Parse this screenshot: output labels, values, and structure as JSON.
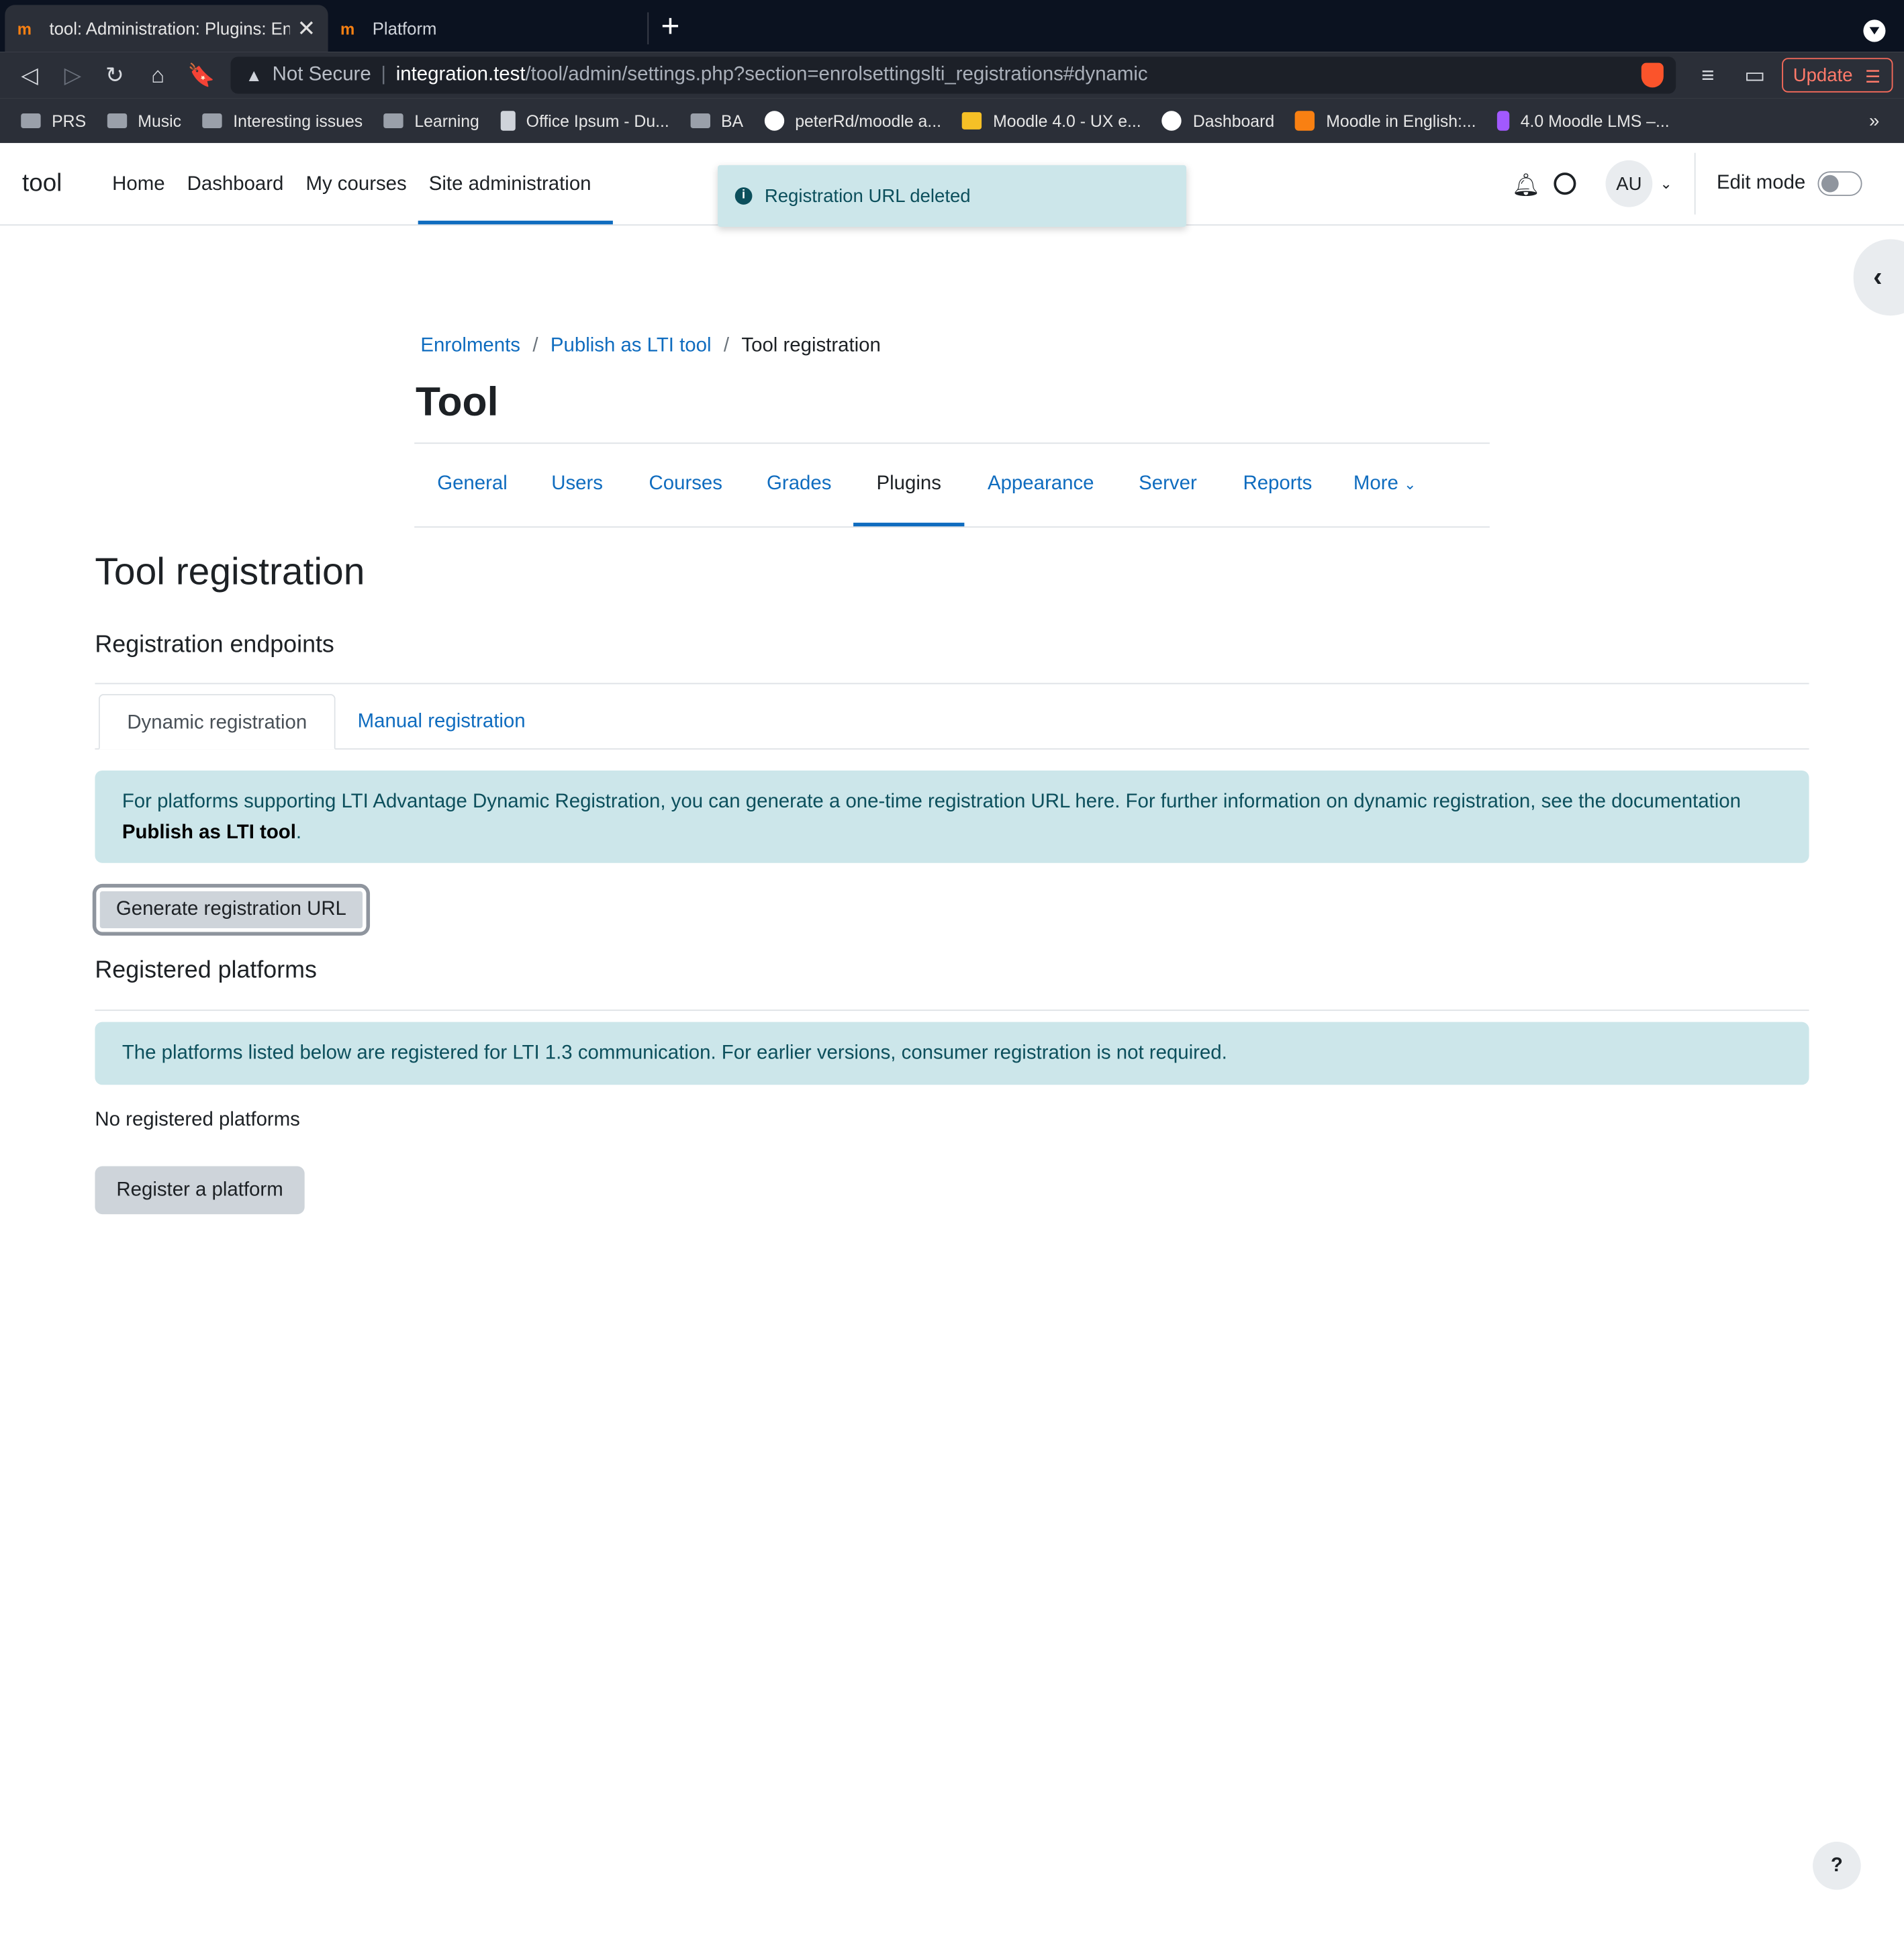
{
  "browser": {
    "tabs": [
      {
        "favicon": "moodle-m",
        "title": "tool: Administration: Plugins: Enrolments",
        "active": true
      },
      {
        "favicon": "moodle-m",
        "title": "Platform",
        "active": false
      }
    ],
    "address": {
      "security": "Not Secure",
      "host": "integration.test",
      "path": "/tool/admin/settings.php?section=enrolsettingslti_registrations#dynamic"
    },
    "update_label": "Update",
    "bookmarks": [
      {
        "icon": "folder",
        "label": "PRS"
      },
      {
        "icon": "folder",
        "label": "Music"
      },
      {
        "icon": "folder",
        "label": "Interesting issues"
      },
      {
        "icon": "folder",
        "label": "Learning"
      },
      {
        "icon": "office",
        "label": "Office Ipsum - Du..."
      },
      {
        "icon": "folder",
        "label": "BA"
      },
      {
        "icon": "github",
        "label": "peterRd/moodle a..."
      },
      {
        "icon": "ux",
        "label": "Moodle 4.0 - UX e..."
      },
      {
        "icon": "dash",
        "label": "Dashboard"
      },
      {
        "icon": "moodle",
        "label": "Moodle in English:..."
      },
      {
        "icon": "figma",
        "label": "4.0 Moodle LMS –..."
      }
    ],
    "bookmarks_more": "»"
  },
  "site": {
    "brand": "tool",
    "primary_nav": [
      "Home",
      "Dashboard",
      "My courses",
      "Site administration"
    ],
    "active_primary": "Site administration",
    "toast": "Registration URL deleted",
    "avatar_initials": "AU",
    "edit_mode_label": "Edit mode",
    "edit_mode_on": false
  },
  "header": {
    "breadcrumb": {
      "links": [
        "Enrolments",
        "Publish as LTI tool"
      ],
      "current": "Tool registration"
    },
    "title": "Tool",
    "secondary_nav": [
      "General",
      "Users",
      "Courses",
      "Grades",
      "Plugins",
      "Appearance",
      "Server",
      "Reports",
      "More"
    ],
    "active_secondary": "Plugins"
  },
  "main": {
    "heading": "Tool registration",
    "endpoints_heading": "Registration endpoints",
    "tabs": [
      "Dynamic registration",
      "Manual registration"
    ],
    "active_tab": "Dynamic registration",
    "dynamic_info_text": "For platforms supporting LTI Advantage Dynamic Registration, you can generate a one-time registration URL here. For further information on dynamic registration, see the documentation ",
    "dynamic_info_bold": "Publish as LTI tool",
    "dynamic_info_end": ".",
    "generate_button": "Generate registration URL",
    "platforms_heading": "Registered platforms",
    "platforms_info": "The platforms listed below are registered for LTI 1.3 communication. For earlier versions, consumer registration is not required.",
    "no_platforms": "No registered platforms",
    "register_button": "Register a platform",
    "help_label": "?"
  },
  "colors": {
    "link": "#0f6cbf",
    "info_bg": "#cce6ea",
    "info_text": "#0c4f5c",
    "button_bg": "#ced4da"
  }
}
